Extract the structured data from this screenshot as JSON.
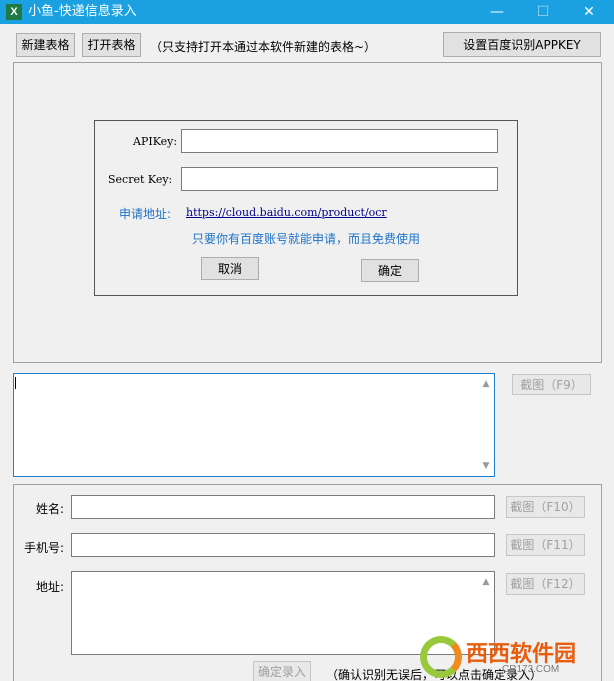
{
  "window": {
    "title": "小鱼-快递信息录入",
    "icon_letter": "X",
    "minimize": "—",
    "maximize": "☐",
    "close": "✕"
  },
  "toolbar": {
    "new_table": "新建表格",
    "open_table": "打开表格",
    "hint": "（只支持打开本通过本软件新建的表格~）",
    "set_appkey": "设置百度识别APPKEY"
  },
  "appkey_dialog": {
    "apikey_label": "APIKey:",
    "apikey_value": "",
    "secret_label": "Secret Key:",
    "secret_value": "",
    "apply_label": "申请地址:",
    "apply_url": "https://cloud.baidu.com/product/ocr",
    "note": "只要你有百度账号就能申请，而且免费使用",
    "cancel": "取消",
    "confirm": "确定"
  },
  "ocr": {
    "text_value": "",
    "capture_f9": "截图（F9）"
  },
  "form": {
    "name_label": "姓名:",
    "name_value": "",
    "capture_f10": "截图（F10）",
    "phone_label": "手机号:",
    "phone_value": "",
    "capture_f11": "截图（F11）",
    "address_label": "地址:",
    "address_value": "",
    "capture_f12": "截图（F12）",
    "submit": "确定录入",
    "submit_hint": "（确认识别无误后，可以点击确定录入）"
  },
  "watermark": {
    "text": "西西软件园",
    "sub": "CR173.COM"
  },
  "colors": {
    "titlebar": "#1ba1e2",
    "link": "#00008b",
    "note": "#1f73c7"
  }
}
